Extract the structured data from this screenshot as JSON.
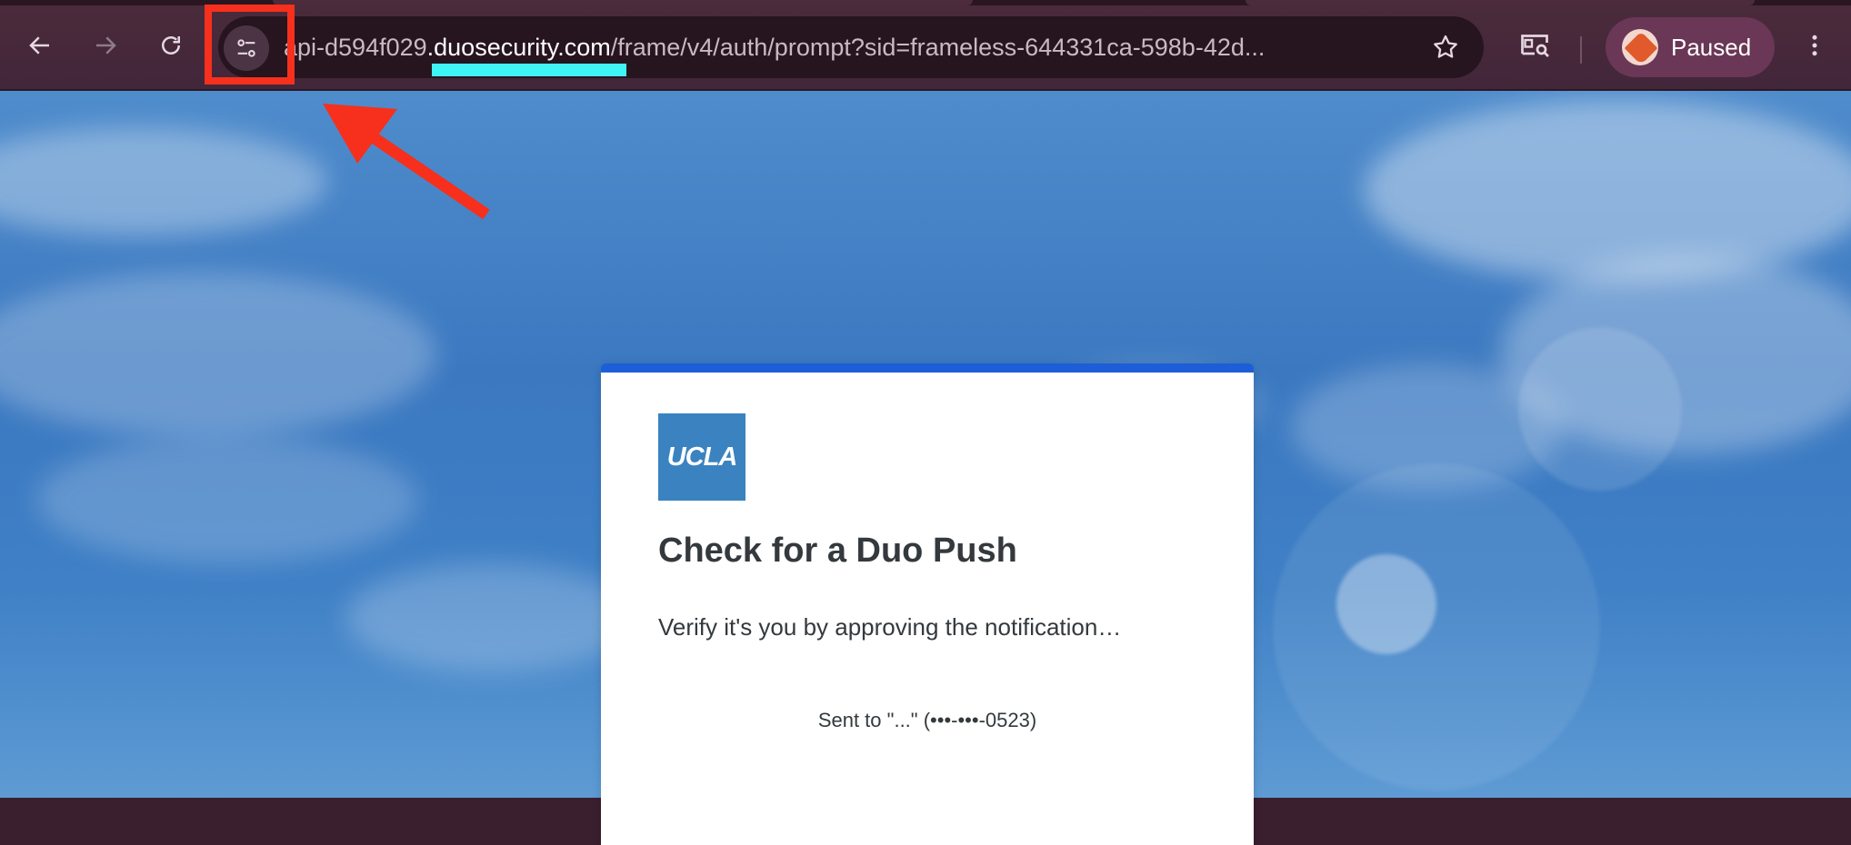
{
  "browser": {
    "url_prefix": "api-d594f029",
    "url_host": ".duosecurity.com",
    "url_path": "/frame/v4/auth/prompt?sid=frameless-644331ca-598b-42d...",
    "profile_label": "Paused",
    "icons": {
      "back": "arrow-left-icon",
      "forward": "arrow-right-icon",
      "reload": "reload-icon",
      "site_info": "tune-icon",
      "bookmark": "star-icon",
      "cast": "cast-search-icon",
      "menu": "kebab-menu-icon"
    }
  },
  "annotations": {
    "highlight_color": "#f6301c",
    "underline_color": "#3ff4f4"
  },
  "card": {
    "logo_text": "UCLA",
    "title": "Check for a Duo Push",
    "subtitle": "Verify it's you by approving the notification…",
    "device_text": "Sent to \"...\" (•••-•••-0523)",
    "accent_color": "#1c5ed8",
    "logo_color": "#3a83c0"
  }
}
